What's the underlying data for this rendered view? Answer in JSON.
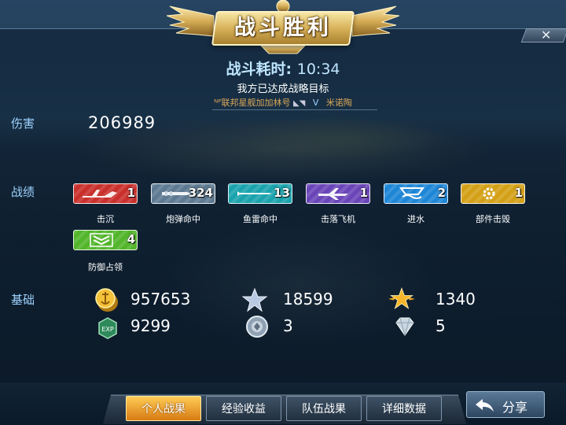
{
  "header": {
    "title": "战斗胜利",
    "battle_time_label": "战斗耗时:",
    "battle_time_value": "10:34",
    "goal_text": "我方已达成战略目标",
    "ship_self": "ᴺᴾ联邦星舰加加林号",
    "vs": "V",
    "ship_enemy": "米诺陶"
  },
  "sections": {
    "damage_label": "伤害",
    "record_label": "战绩",
    "basic_label": "基础"
  },
  "damage_value": "206989",
  "stats": [
    {
      "label": "击沉",
      "count": "1",
      "color": "#c9302c",
      "icon": "plane-sink-icon"
    },
    {
      "label": "炮弹命中",
      "count": "324",
      "color": "#5e7a92",
      "icon": "shell-icon"
    },
    {
      "label": "鱼雷命中",
      "count": "13",
      "color": "#1aa3ad",
      "icon": "torpedo-icon"
    },
    {
      "label": "击落飞机",
      "count": "1",
      "color": "#6a45b8",
      "icon": "aircraft-icon"
    },
    {
      "label": "进水",
      "count": "2",
      "color": "#1e86d6",
      "icon": "flooding-icon"
    },
    {
      "label": "部件击毁",
      "count": "1",
      "color": "#d4a017",
      "icon": "gear-icon"
    },
    {
      "label": "防御占领",
      "count": "4",
      "color": "#52b52a",
      "icon": "chevron-defend-icon"
    }
  ],
  "resources": {
    "gold": "957653",
    "star_silver": "18599",
    "star_gold": "1340",
    "exp": "9299",
    "medal": "3",
    "diamond": "5",
    "exp_badge": "EXP"
  },
  "tabs": [
    {
      "label": "个人战果",
      "active": true
    },
    {
      "label": "经验收益",
      "active": false
    },
    {
      "label": "队伍战果",
      "active": false
    },
    {
      "label": "详细数据",
      "active": false
    }
  ],
  "share_label": "分享",
  "close_glyph": "✕"
}
